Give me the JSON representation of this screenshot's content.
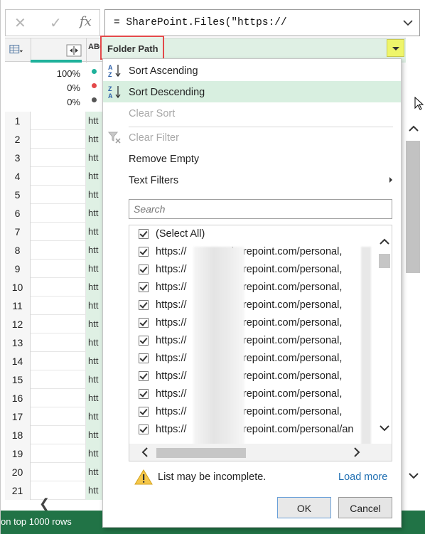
{
  "formula_bar": {
    "cancel_icon": "close-icon",
    "accept_icon": "check-icon",
    "fx_label": "fx",
    "formula": "= SharePoint.Files(\"https://"
  },
  "grid": {
    "col_b_type": "ABC",
    "active_column": "Folder Path",
    "quality": {
      "valid": "100%",
      "error": "0%",
      "empty": "0%"
    },
    "quality_colors": {
      "valid": "#1fb19b",
      "error": "#e3494a",
      "empty": "#555555"
    },
    "rows": [
      {
        "num": "1",
        "b": "htt"
      },
      {
        "num": "2",
        "b": "htt"
      },
      {
        "num": "3",
        "b": "htt"
      },
      {
        "num": "4",
        "b": "htt"
      },
      {
        "num": "5",
        "b": "htt"
      },
      {
        "num": "6",
        "b": "htt"
      },
      {
        "num": "7",
        "b": "htt"
      },
      {
        "num": "8",
        "b": "htt"
      },
      {
        "num": "9",
        "b": "htt"
      },
      {
        "num": "10",
        "b": "htt"
      },
      {
        "num": "11",
        "b": "htt"
      },
      {
        "num": "12",
        "b": "htt"
      },
      {
        "num": "13",
        "b": "htt"
      },
      {
        "num": "14",
        "b": "htt"
      },
      {
        "num": "15",
        "b": "htt"
      },
      {
        "num": "16",
        "b": "htt"
      },
      {
        "num": "17",
        "b": "htt"
      },
      {
        "num": "18",
        "b": "htt"
      },
      {
        "num": "19",
        "b": "htt"
      },
      {
        "num": "20",
        "b": "htt"
      },
      {
        "num": "21",
        "b": "htt"
      }
    ]
  },
  "status_bar": {
    "text": "on top 1000 rows"
  },
  "menu": {
    "sort_ascending": "Sort Ascending",
    "sort_descending": "Sort Descending",
    "clear_sort": "Clear Sort",
    "clear_filter": "Clear Filter",
    "remove_empty": "Remove Empty",
    "text_filters": "Text Filters",
    "search_placeholder": "Search",
    "select_all": "(Select All)",
    "values": [
      "https://",
      "https://",
      "https://",
      "https://",
      "https://",
      "https://",
      "https://",
      "https://",
      "https://",
      "https://",
      "https://"
    ],
    "value_suffix": "sharepoint.com/personal,",
    "value_suffix_last": "sharepoint.com/personal/an",
    "warning": "List may be incomplete.",
    "load_more": "Load more",
    "ok": "OK",
    "cancel": "Cancel"
  }
}
